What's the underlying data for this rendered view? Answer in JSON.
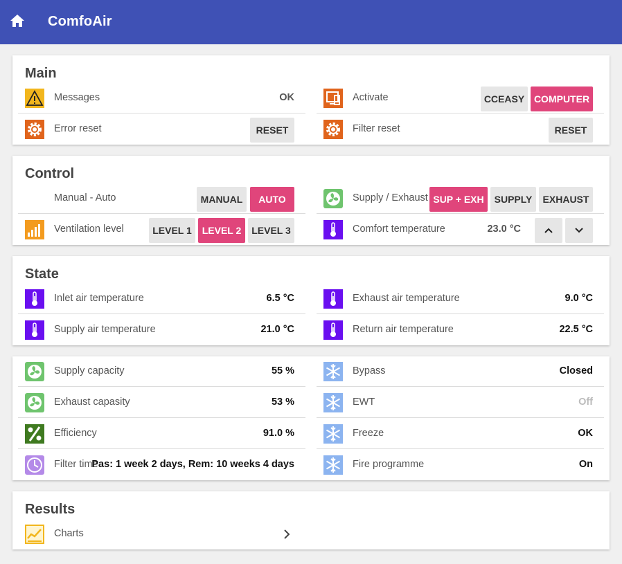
{
  "app": {
    "title": "ComfoAir"
  },
  "main": {
    "title": "Main",
    "messages": {
      "label": "Messages",
      "value": "OK"
    },
    "error_reset": {
      "label": "Error reset",
      "button": "RESET"
    },
    "activate": {
      "label": "Activate",
      "options": [
        "CCEASY",
        "COMPUTER"
      ],
      "selected": "COMPUTER"
    },
    "filter_reset": {
      "label": "Filter reset",
      "button": "RESET"
    }
  },
  "control": {
    "title": "Control",
    "manual_auto": {
      "label": "Manual - Auto",
      "options": [
        "MANUAL",
        "AUTO"
      ],
      "selected": "AUTO"
    },
    "supply_exhaust": {
      "label": "Supply / Exhaust",
      "options": [
        "SUP + EXH",
        "SUPPLY",
        "EXHAUST"
      ],
      "selected": "SUP + EXH"
    },
    "ventilation_level": {
      "label": "Ventilation level",
      "options": [
        "LEVEL 1",
        "LEVEL 2",
        "LEVEL 3"
      ],
      "selected": "LEVEL 2"
    },
    "comfort_temperature": {
      "label": "Comfort temperature",
      "value": "23.0 °C"
    }
  },
  "state": {
    "title": "State",
    "inlet_air": {
      "label": "Inlet air temperature",
      "value": "6.5 °C"
    },
    "exhaust_air": {
      "label": "Exhaust air temperature",
      "value": "9.0 °C"
    },
    "supply_air": {
      "label": "Supply air temperature",
      "value": "21.0 °C"
    },
    "return_air": {
      "label": "Return air temperature",
      "value": "22.5 °C"
    }
  },
  "status": {
    "supply_capacity": {
      "label": "Supply capacity",
      "value": "55 %"
    },
    "exhaust_capacity": {
      "label": "Exhaust capasity",
      "value": "53 %"
    },
    "efficiency": {
      "label": "Efficiency",
      "value": "91.0 %"
    },
    "filter_time": {
      "label": "Filter time",
      "value": "Pas: 1 week 2 days, Rem: 10 weeks 4 days"
    },
    "bypass": {
      "label": "Bypass",
      "value": "Closed"
    },
    "ewt": {
      "label": "EWT",
      "value": "Off"
    },
    "freeze": {
      "label": "Freeze",
      "value": "OK"
    },
    "fire_programme": {
      "label": "Fire programme",
      "value": "On"
    }
  },
  "results": {
    "title": "Results",
    "charts": {
      "label": "Charts"
    }
  },
  "colors": {
    "header": "#3f51b5",
    "accent": "#e0457b",
    "warning": "#f2b61d",
    "orange": "#e0641c",
    "purple": "#6a0ff0",
    "green": "#6fc46e",
    "dark_green": "#3f7a20",
    "light_purple": "#b48ae8",
    "snow_blue": "#8cb4f0"
  }
}
